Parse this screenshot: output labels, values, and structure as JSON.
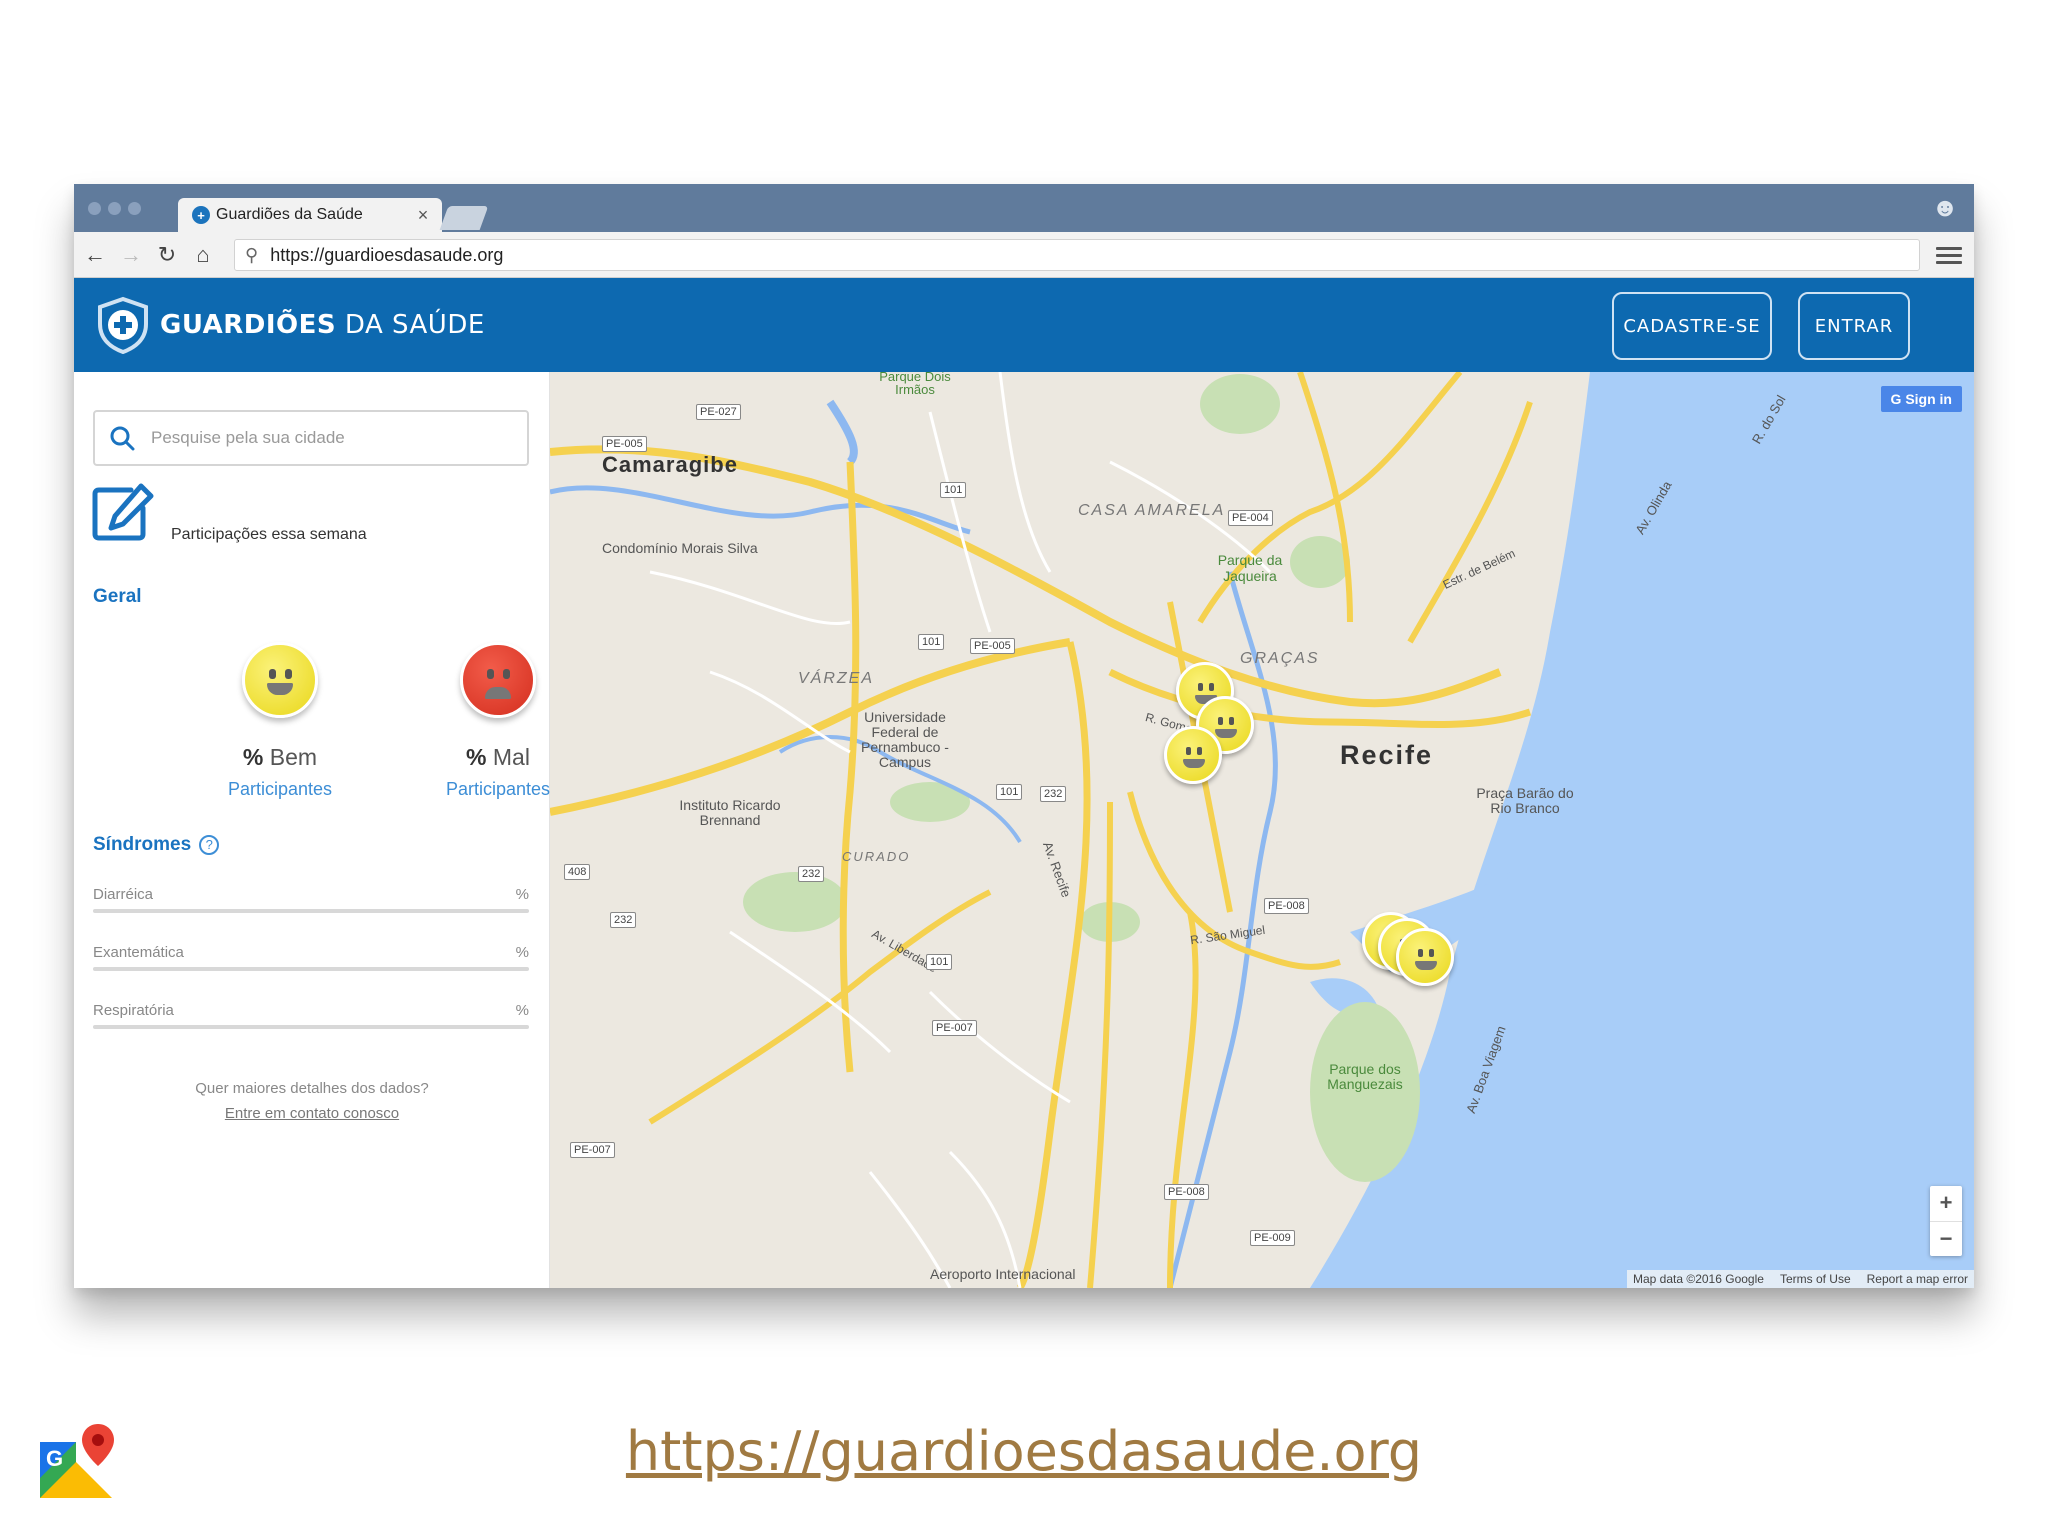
{
  "browser": {
    "tab_title": "Guardiões da Saúde",
    "tab_close": "×",
    "url": "https://guardioesdasaude.org"
  },
  "header": {
    "logo_strong": "GUARDIÕES",
    "logo_light": " DA SAÚDE",
    "signup_label": "CADASTRE-SE",
    "login_label": "ENTRAR",
    "brand_color": "#0d69b0"
  },
  "sidebar": {
    "search_placeholder": "Pesquise pela sua cidade",
    "participations_label": "Participações essa semana",
    "general_title": "Geral",
    "good": {
      "pct": "%",
      "label": "Bem",
      "participants": "Participantes"
    },
    "bad": {
      "pct": "%",
      "label": "Mal",
      "participants": "Participantes"
    },
    "syndromes_title": "Síndromes",
    "syndromes": [
      {
        "name": "Diarréica",
        "unit": "%"
      },
      {
        "name": "Exantemática",
        "unit": "%"
      },
      {
        "name": "Respiratória",
        "unit": "%"
      }
    ],
    "more_question": "Quer maiores detalhes dos dados?",
    "contact_link": "Entre em contato conosco"
  },
  "map": {
    "signin_label": "G Sign in",
    "zoom_in": "+",
    "zoom_out": "−",
    "attribution": [
      "Map data ©2016 Google",
      "Terms of Use",
      "Report a map error"
    ],
    "labels": {
      "camaragibe": "Camaragibe",
      "recife": "Recife",
      "casa_amarela": "CASA AMARELA",
      "gracas": "GRAÇAS",
      "varzea": "VÁRZEA",
      "curado": "CURADO",
      "condominio": "Condomínio Morais Silva",
      "parque_jaqueira": "Parque da Jaqueira",
      "ufpe": "Universidade Federal de Pernambuco - Campus",
      "brennand": "Instituto Ricardo Brennand",
      "praca": "Praça Barão do Rio Branco",
      "manguezais": "Parque dos Manguezais",
      "aeroporto": "Aeroporto Internacional",
      "dois_irmaos": "Parque Dois Irmãos",
      "av_olinda": "Av. Olinda",
      "r_do_sol": "R. do Sol",
      "av_boa_viagem": "Av. Boa Viagem",
      "av_recife": "Av. Recife",
      "r_sao_miguel": "R. São Miguel",
      "av_liberdade": "Av. Liberdade",
      "r_gomes_taborda": "R. Gomes Tabora",
      "estr_belem": "Estr. de Belém"
    },
    "route_shields": [
      "PE-027",
      "PE-005",
      "101",
      "PE-004",
      "101",
      "PE-005",
      "101",
      "232",
      "232",
      "408",
      "232",
      "101",
      "PE-007",
      "PE-008",
      "PE-008",
      "PE-009",
      "PE-007"
    ]
  },
  "footer": {
    "url": "https://guardioesdasaude.org"
  },
  "icons": {
    "search": "search-icon",
    "edit": "edit-icon",
    "help": "help-icon",
    "shield": "shield-plus-icon",
    "maps": "google-maps-icon"
  }
}
